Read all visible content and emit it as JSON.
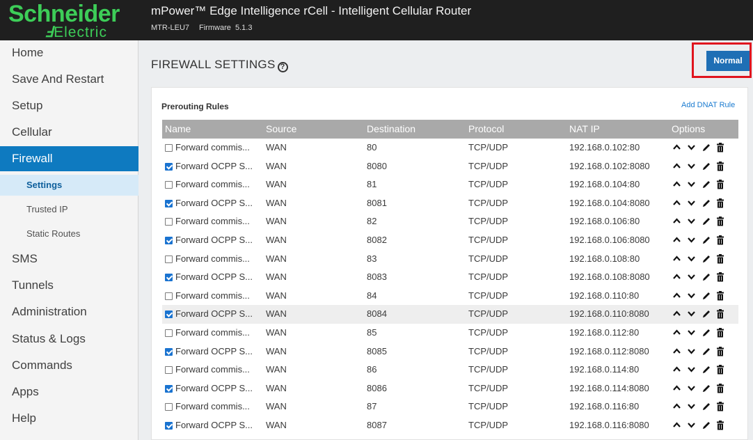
{
  "header": {
    "logo_main": "Schneider",
    "logo_sub": "Electric",
    "app_title": "mPower™ Edge Intelligence rCell - Intelligent Cellular Router",
    "model": "MTR-LEU7",
    "firmware_label": "Firmware",
    "firmware_version": "5.1.3"
  },
  "sidebar": {
    "items": [
      {
        "label": "Home"
      },
      {
        "label": "Save And Restart"
      },
      {
        "label": "Setup"
      },
      {
        "label": "Cellular"
      },
      {
        "label": "Firewall",
        "active": true
      },
      {
        "label": "SMS"
      },
      {
        "label": "Tunnels"
      },
      {
        "label": "Administration"
      },
      {
        "label": "Status & Logs"
      },
      {
        "label": "Commands"
      },
      {
        "label": "Apps"
      },
      {
        "label": "Help"
      }
    ],
    "subitems": [
      {
        "label": "Settings",
        "active": true
      },
      {
        "label": "Trusted IP"
      },
      {
        "label": "Static Routes"
      }
    ]
  },
  "main": {
    "title": "FIREWALL SETTINGS",
    "mode_button": "Normal",
    "section_title": "Prerouting Rules",
    "add_link": "Add DNAT Rule",
    "columns": [
      "Name",
      "Source",
      "Destination",
      "Protocol",
      "NAT IP",
      "Options"
    ],
    "rows": [
      {
        "checked": false,
        "name": "Forward commis...",
        "source": "WAN",
        "destination": "80",
        "protocol": "TCP/UDP",
        "nat_ip": "192.168.0.102:80"
      },
      {
        "checked": true,
        "name": "Forward OCPP S...",
        "source": "WAN",
        "destination": "8080",
        "protocol": "TCP/UDP",
        "nat_ip": "192.168.0.102:8080"
      },
      {
        "checked": false,
        "name": "Forward commis...",
        "source": "WAN",
        "destination": "81",
        "protocol": "TCP/UDP",
        "nat_ip": "192.168.0.104:80"
      },
      {
        "checked": true,
        "name": "Forward OCPP S...",
        "source": "WAN",
        "destination": "8081",
        "protocol": "TCP/UDP",
        "nat_ip": "192.168.0.104:8080"
      },
      {
        "checked": false,
        "name": "Forward commis...",
        "source": "WAN",
        "destination": "82",
        "protocol": "TCP/UDP",
        "nat_ip": "192.168.0.106:80"
      },
      {
        "checked": true,
        "name": "Forward OCPP S...",
        "source": "WAN",
        "destination": "8082",
        "protocol": "TCP/UDP",
        "nat_ip": "192.168.0.106:8080"
      },
      {
        "checked": false,
        "name": "Forward commis...",
        "source": "WAN",
        "destination": "83",
        "protocol": "TCP/UDP",
        "nat_ip": "192.168.0.108:80"
      },
      {
        "checked": true,
        "name": "Forward OCPP S...",
        "source": "WAN",
        "destination": "8083",
        "protocol": "TCP/UDP",
        "nat_ip": "192.168.0.108:8080"
      },
      {
        "checked": false,
        "name": "Forward commis...",
        "source": "WAN",
        "destination": "84",
        "protocol": "TCP/UDP",
        "nat_ip": "192.168.0.110:80"
      },
      {
        "checked": true,
        "name": "Forward OCPP S...",
        "source": "WAN",
        "destination": "8084",
        "protocol": "TCP/UDP",
        "nat_ip": "192.168.0.110:8080",
        "hover": true
      },
      {
        "checked": false,
        "name": "Forward commis...",
        "source": "WAN",
        "destination": "85",
        "protocol": "TCP/UDP",
        "nat_ip": "192.168.0.112:80"
      },
      {
        "checked": true,
        "name": "Forward OCPP S...",
        "source": "WAN",
        "destination": "8085",
        "protocol": "TCP/UDP",
        "nat_ip": "192.168.0.112:8080"
      },
      {
        "checked": false,
        "name": "Forward commis...",
        "source": "WAN",
        "destination": "86",
        "protocol": "TCP/UDP",
        "nat_ip": "192.168.0.114:80"
      },
      {
        "checked": true,
        "name": "Forward OCPP S...",
        "source": "WAN",
        "destination": "8086",
        "protocol": "TCP/UDP",
        "nat_ip": "192.168.0.114:8080"
      },
      {
        "checked": false,
        "name": "Forward commis...",
        "source": "WAN",
        "destination": "87",
        "protocol": "TCP/UDP",
        "nat_ip": "192.168.0.116:80"
      },
      {
        "checked": true,
        "name": "Forward OCPP S...",
        "source": "WAN",
        "destination": "8087",
        "protocol": "TCP/UDP",
        "nat_ip": "192.168.0.116:8080"
      }
    ],
    "option_icons": [
      "chevron-up-icon",
      "chevron-down-icon",
      "pencil-icon",
      "trash-icon"
    ]
  },
  "colors": {
    "brand_green": "#3dcd58",
    "accent_blue": "#0e7ac0",
    "highlight_red": "#e0141e"
  }
}
